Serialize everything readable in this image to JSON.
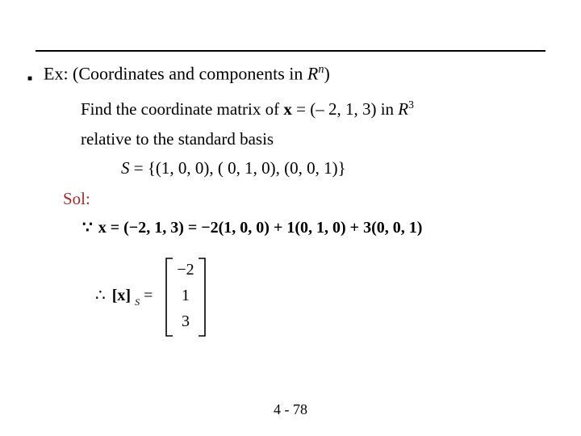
{
  "headline": {
    "prefix": "Ex: (Coordinates and components in ",
    "space_sym": "R",
    "space_sup": "n",
    "suffix": ")"
  },
  "problem": {
    "line1_a": "Find the coordinate matrix of  ",
    "line1_vec": "x",
    "line1_b": " = (– 2, 1, 3) in  ",
    "line1_space": "R",
    "line1_sup": "3",
    "line2": "relative to the standard basis",
    "line3_a": "S",
    "line3_b": " = {(1, 0, 0), ( 0, 1, 0), (0, 0, 1)}"
  },
  "sol_label": "Sol:",
  "math": {
    "because_glyph": "∵",
    "eq_prefix": "x = (−2,  1,  3) = −2(1,  0,  0) + 1(0,  1,  0) + 3(0,  0,  1)",
    "therefore_glyph": "∴",
    "bracket_lhs": "[x]",
    "bracket_sub": "S",
    "equals": " = ",
    "col": [
      "−2",
      "1",
      "3"
    ]
  },
  "footer": "4 - 78"
}
